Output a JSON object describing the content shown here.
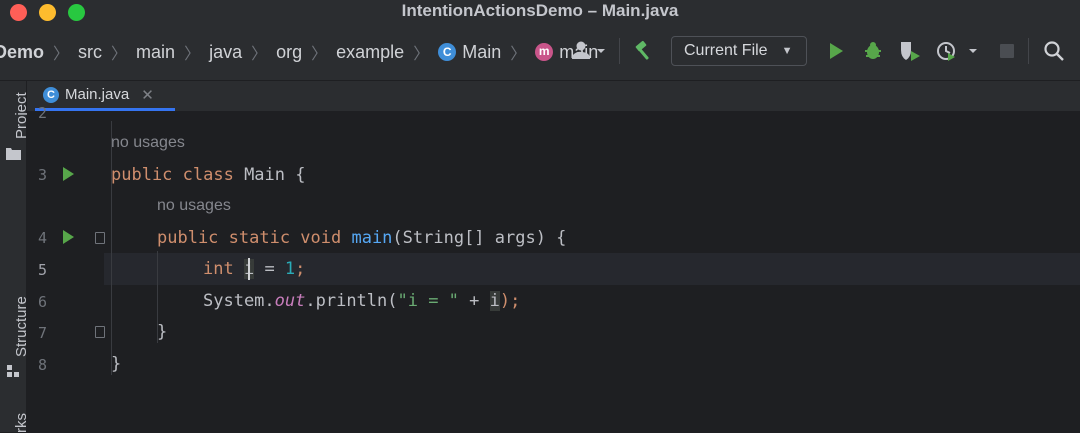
{
  "window": {
    "title": "IntentionActionsDemo – Main.java"
  },
  "breadcrumbs": [
    {
      "label": "Demo",
      "icon": ""
    },
    {
      "label": "src",
      "icon": ""
    },
    {
      "label": "main",
      "icon": ""
    },
    {
      "label": "java",
      "icon": ""
    },
    {
      "label": "org",
      "icon": ""
    },
    {
      "label": "example",
      "icon": ""
    },
    {
      "label": "Main",
      "icon": "class-icon"
    },
    {
      "label": "main",
      "icon": "method-icon"
    }
  ],
  "toolbar": {
    "run_config": "Current File",
    "icons": [
      "vcs-user-icon",
      "build-hammer-icon",
      "run-icon",
      "debug-icon",
      "coverage-icon",
      "profile-icon",
      "stop-icon",
      "search-icon"
    ]
  },
  "side_panels": {
    "project": "Project",
    "structure": "Structure",
    "bookmarks": "rks"
  },
  "tab": {
    "label": "Main.java",
    "close": "✕"
  },
  "hints": {
    "class_usages": "no usages",
    "method_usages": "no usages"
  },
  "lines": [
    {
      "num": "2"
    },
    {
      "num": "3",
      "text": {
        "kw": "public class ",
        "name": "Main {"
      }
    },
    {
      "num": "4",
      "text": {
        "kw": "public static void ",
        "fn": "main",
        "rest": "(String[] args) {"
      }
    },
    {
      "num": "5",
      "text": {
        "kw": "int ",
        "var": "i",
        "eq": " = ",
        "num": "1",
        "semi": ";"
      }
    },
    {
      "num": "6",
      "text": {
        "a": "System.",
        "field": "out",
        "b": ".println(",
        "str": "\"i = \"",
        "c": " + ",
        "var": "i",
        "d": ");"
      }
    },
    {
      "num": "7",
      "text": {
        "brace": "}"
      }
    },
    {
      "num": "8",
      "text": {
        "brace": "}"
      }
    }
  ],
  "colors": {
    "keyword": "#cf8e6d",
    "function": "#56a8f5",
    "number": "#2aacb8",
    "string": "#6aab73",
    "field": "#c77dbb",
    "accent": "#3574f0",
    "run_green": "#57a64a"
  }
}
